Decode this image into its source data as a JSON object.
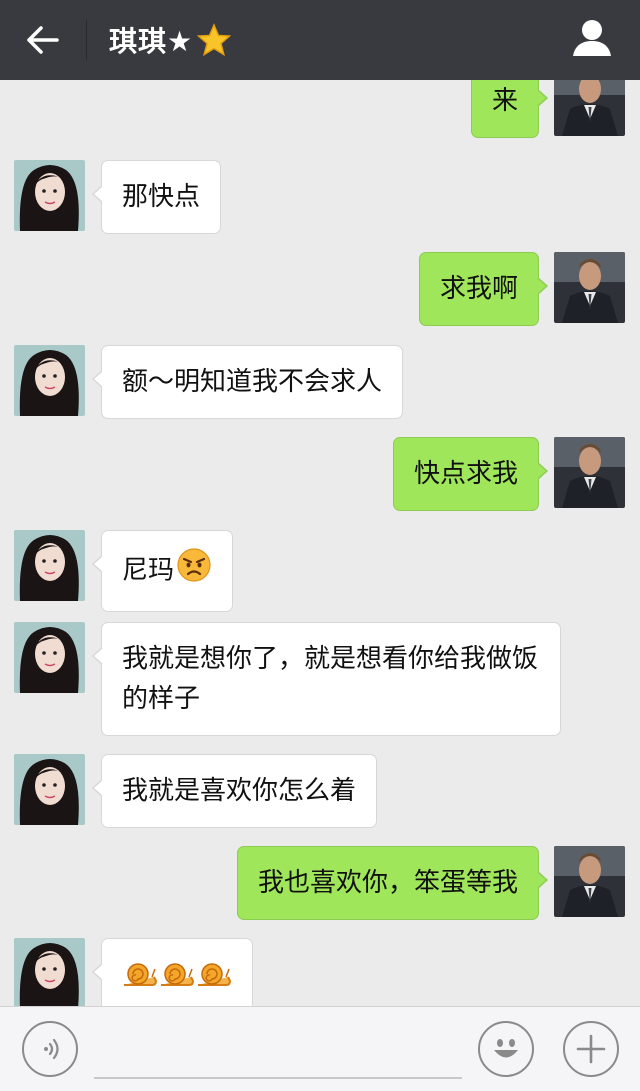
{
  "header": {
    "contact_name": "琪琪★",
    "star_icon": "star-emoji-icon",
    "back_icon": "back-arrow-icon",
    "profile_icon": "person-icon",
    "bg_color": "#393a3f"
  },
  "messages": [
    {
      "side": "out",
      "text": "来"
    },
    {
      "side": "in",
      "text": "那快点"
    },
    {
      "side": "out",
      "text": "求我啊"
    },
    {
      "side": "in",
      "text": "额～明知道我不会求人"
    },
    {
      "side": "out",
      "text": "快点求我"
    },
    {
      "side": "in",
      "text": "尼玛",
      "emoji": "angry-face-icon"
    },
    {
      "side": "in",
      "text": "我就是想你了，就是想看你给我做饭的样子"
    },
    {
      "side": "in",
      "text": "我就是喜欢你怎么着"
    },
    {
      "side": "out",
      "text": "我也喜欢你，笨蛋等我"
    },
    {
      "side": "in",
      "text": "",
      "emoji": "snail-icon"
    }
  ],
  "colors": {
    "outgoing_bubble": "#9fe65b",
    "incoming_bubble": "#ffffff",
    "chat_background": "#ebebeb"
  },
  "input_bar": {
    "voice_icon": "voice-icon",
    "emoji_icon": "smiley-icon",
    "plus_icon": "plus-icon",
    "placeholder": ""
  }
}
